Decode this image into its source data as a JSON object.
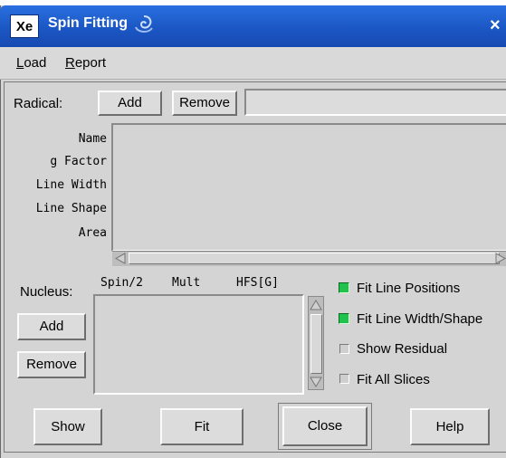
{
  "window": {
    "app_icon_text": "Xe",
    "title": "Spin Fitting",
    "close_glyph": "×"
  },
  "menu": [
    {
      "label": "Load",
      "accel": "L",
      "rest": "oad"
    },
    {
      "label": "Report",
      "accel": "R",
      "rest": "eport"
    }
  ],
  "radical": {
    "label": "Radical:",
    "add_label": "Add",
    "remove_label": "Remove",
    "name_value": ""
  },
  "properties": [
    "Name",
    "g Factor",
    "Line Width",
    "Line Shape",
    "Area"
  ],
  "nucleus": {
    "label": "Nucleus:",
    "columns": [
      "Spin/2",
      "Mult",
      "HFS[G]"
    ],
    "add_label": "Add",
    "remove_label": "Remove"
  },
  "options": [
    {
      "label": "Fit Line Positions",
      "checked": true
    },
    {
      "label": "Fit Line Width/Shape",
      "checked": true
    },
    {
      "label": "Show Residual",
      "checked": false
    },
    {
      "label": "Fit All Slices",
      "checked": false
    }
  ],
  "actions": {
    "show": "Show",
    "fit": "Fit",
    "close": "Close",
    "help": "Help"
  },
  "colors": {
    "title_bar": "#1b57c4",
    "checked": "#1fc24a"
  }
}
